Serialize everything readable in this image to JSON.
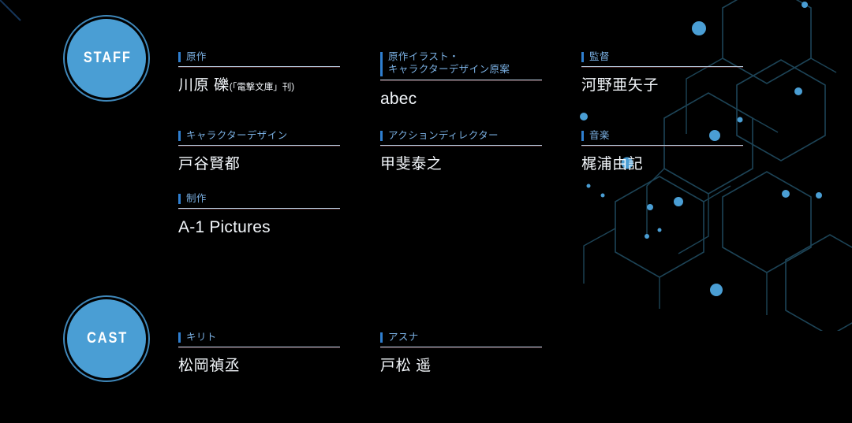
{
  "theme": {
    "background": "#000000",
    "badge_fill": "#4a9ed4",
    "accent_bar": "#2f7fd0",
    "label_text": "#79aee0",
    "value_text": "#f2f6fa",
    "divider": "#b9cfe4",
    "hex_line": "#1d4457",
    "hex_node": "#4a9ed4"
  },
  "sections": [
    {
      "badge": "STAFF",
      "credits": [
        {
          "label": "原作",
          "value": "川原 礫",
          "value_sub": "(「電撃文庫」刊)",
          "lines": 1,
          "latin": false
        },
        {
          "label": "原作イラスト・\nキャラクターデザイン原案",
          "value": "abec",
          "value_sub": "",
          "lines": 2,
          "latin": true
        },
        {
          "label": "監督",
          "value": "河野亜矢子",
          "value_sub": "",
          "lines": 1,
          "latin": false
        },
        {
          "label": "キャラクターデザイン",
          "value": "戸谷賢都",
          "value_sub": "",
          "lines": 1,
          "latin": false
        },
        {
          "label": "アクションディレクター",
          "value": "甲斐泰之",
          "value_sub": "",
          "lines": 1,
          "latin": false
        },
        {
          "label": "音楽",
          "value": "梶浦由記",
          "value_sub": "",
          "lines": 1,
          "latin": false
        },
        {
          "label": "制作",
          "value": "A-1 Pictures",
          "value_sub": "",
          "lines": 1,
          "latin": true
        }
      ]
    },
    {
      "badge": "CAST",
      "credits": [
        {
          "label": "キリト",
          "value": "松岡禎丞",
          "value_sub": "",
          "lines": 1,
          "latin": false
        },
        {
          "label": "アスナ",
          "value": "戸松 遥",
          "value_sub": "",
          "lines": 1,
          "latin": false
        }
      ]
    }
  ]
}
